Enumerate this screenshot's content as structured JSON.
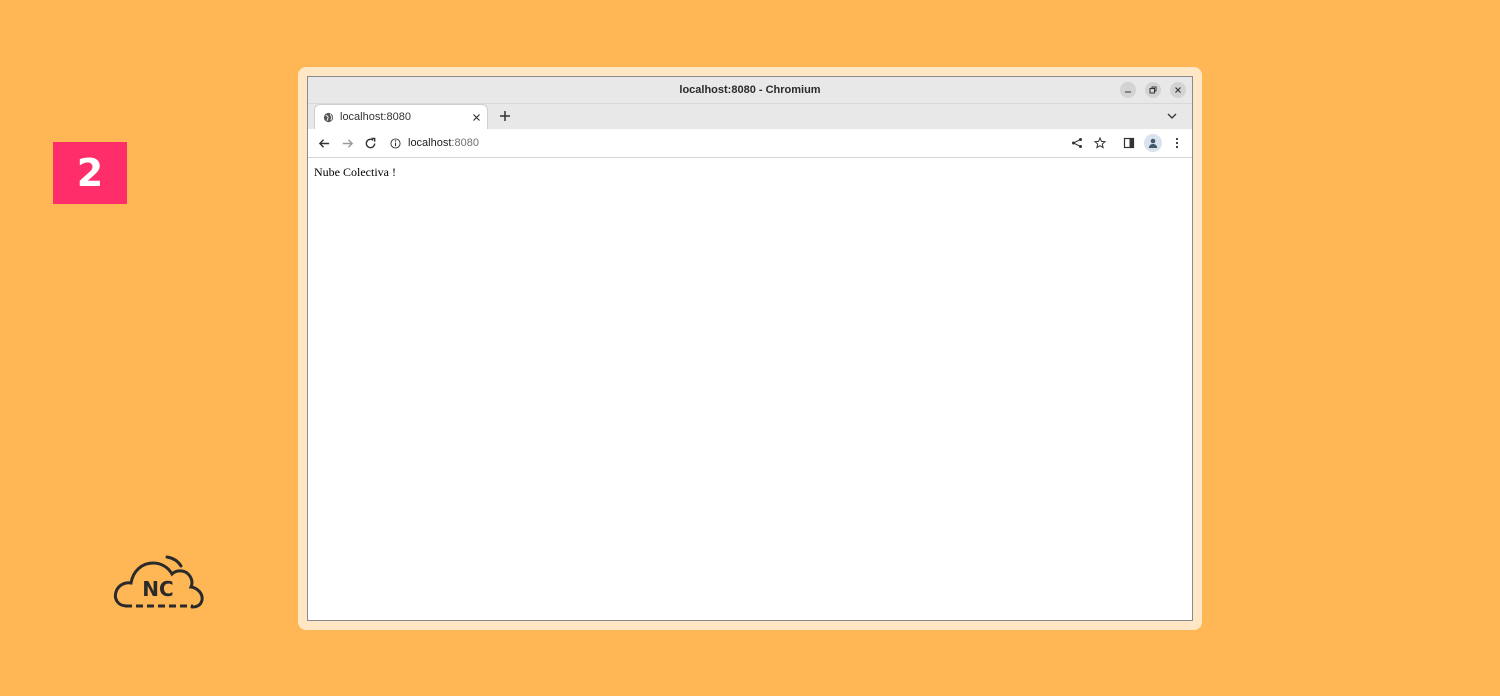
{
  "badge": {
    "number": "2",
    "color": "#FF2D6A"
  },
  "logo": {
    "text": "NC"
  },
  "browser": {
    "window_title": "localhost:8080 - Chromium",
    "tab": {
      "title": "localhost:8080",
      "icon": "globe-icon"
    },
    "address": {
      "host": "localhost",
      "port": ":8080"
    },
    "page_text": "Nube Colectiva !"
  },
  "colors": {
    "background": "#FFB756",
    "frame": "#FFE6C4"
  }
}
